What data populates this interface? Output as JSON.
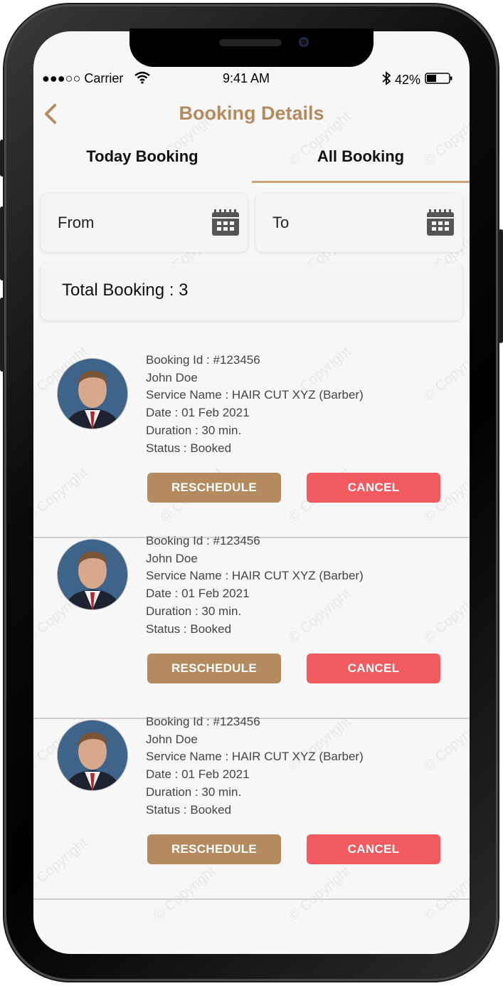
{
  "status_bar": {
    "carrier": "●●●○○ Carrier",
    "time": "9:41 AM",
    "battery": "42%"
  },
  "header": {
    "title": "Booking Details",
    "back_icon": "chevron-left-icon"
  },
  "tabs": [
    {
      "label": "Today Booking",
      "active": false
    },
    {
      "label": "All Booking",
      "active": true
    }
  ],
  "filters": {
    "from_label": "From",
    "to_label": "To",
    "calendar_icon": "calendar-icon"
  },
  "total": {
    "label": "Total Booking : 3"
  },
  "bookings": [
    {
      "id_text": "Booking Id : #123456",
      "name": "John Doe",
      "service": "Service Name : HAIR CUT XYZ (Barber)",
      "date": "Date : 01 Feb 2021",
      "duration": "Duration : 30 min.",
      "status": "Status : Booked",
      "reschedule_label": "RESCHEDULE",
      "cancel_label": "CANCEL"
    },
    {
      "id_text": "Booking Id : #123456",
      "name": "John Doe",
      "service": "Service Name : HAIR CUT XYZ (Barber)",
      "date": "Date : 01 Feb 2021",
      "duration": "Duration : 30 min.",
      "status": "Status : Booked",
      "reschedule_label": "RESCHEDULE",
      "cancel_label": "CANCEL"
    },
    {
      "id_text": "Booking Id : #123456",
      "name": "John Doe",
      "service": "Service Name : HAIR CUT XYZ (Barber)",
      "date": "Date : 01 Feb 2021",
      "duration": "Duration : 30 min.",
      "status": "Status : Booked",
      "reschedule_label": "RESCHEDULE",
      "cancel_label": "CANCEL"
    }
  ],
  "watermark": "© Copyright",
  "colors": {
    "accent": "#b38b5e",
    "cancel": "#f15a5e",
    "background": "#f7f7f7"
  }
}
